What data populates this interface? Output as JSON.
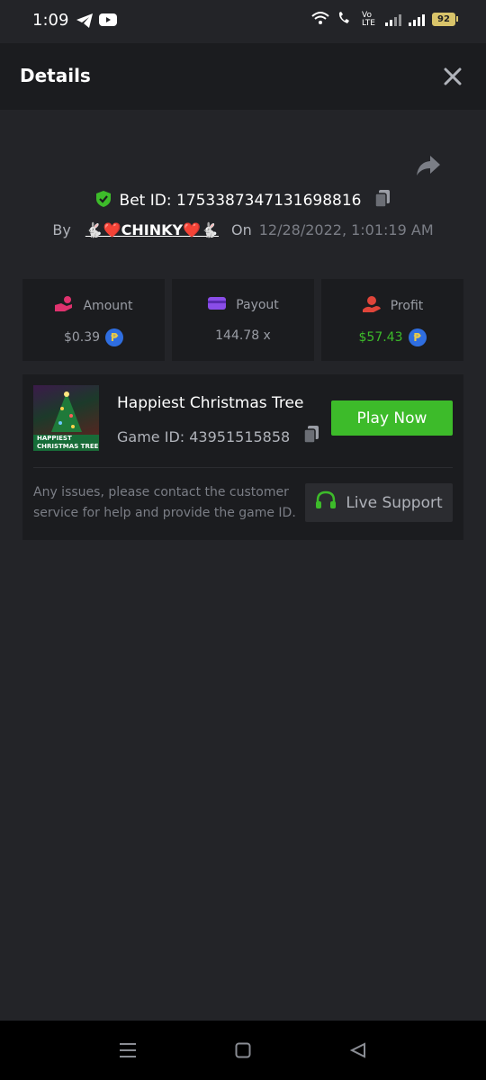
{
  "status_bar": {
    "time": "1:09",
    "battery": "92",
    "network_label": "Vo LTE"
  },
  "header": {
    "title": "Details"
  },
  "bet": {
    "bet_id_label": "Bet ID: 1753387347131698816",
    "by_label": "By",
    "user_name": "🐇❤️CHINKY❤️🐇",
    "on_label": "On",
    "date": "12/28/2022, 1:01:19 AM"
  },
  "stats": {
    "amount": {
      "label": "Amount",
      "value": "$0.39"
    },
    "payout": {
      "label": "Payout",
      "value": "144.78 x"
    },
    "profit": {
      "label": "Profit",
      "value": "$57.43"
    },
    "coin_symbol": "₱"
  },
  "game": {
    "title": "Happiest Christmas Tree",
    "game_id_label": "Game ID: 43951515858",
    "thumb_caption_line1": "HAPPIEST",
    "thumb_caption_line2": "CHRISTMAS TREE",
    "play_label": "Play Now",
    "issue_text": "Any issues, please contact the customer service for help and provide the game ID.",
    "support_label": "Live Support"
  },
  "colors": {
    "background": "#232428",
    "card": "#1b1c1f",
    "play_green": "#3dbb2a",
    "profit_green": "#3dbb2a",
    "amount_pink": "#e0326e",
    "payout_purple": "#8a4de8",
    "profit_red": "#e0453a",
    "coin_blue": "#2f6ee0"
  },
  "icons": {
    "share": "share-icon",
    "close": "close-icon",
    "shield": "shield-check-icon",
    "copy": "copy-icon",
    "headset": "headset-icon"
  }
}
